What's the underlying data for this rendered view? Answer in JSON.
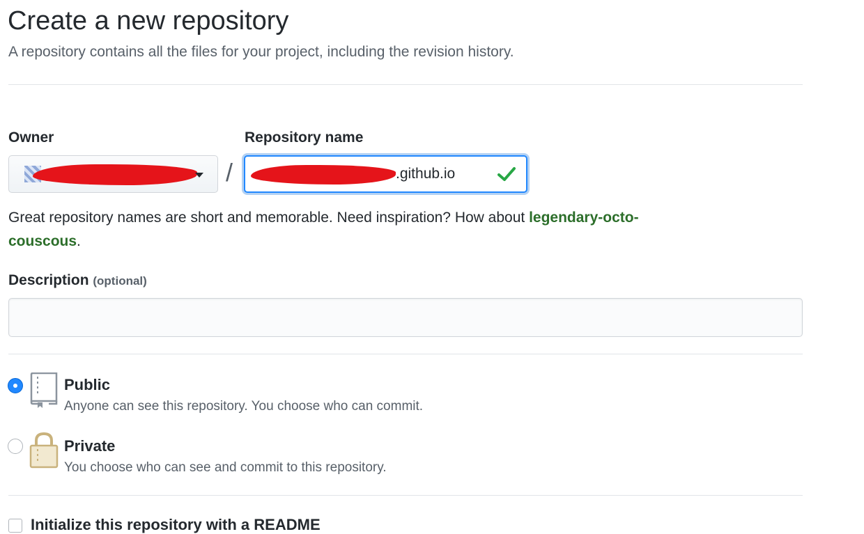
{
  "header": {
    "title": "Create a new repository",
    "subtitle": "A repository contains all the files for your project, including the revision history."
  },
  "owner": {
    "label": "Owner",
    "value": ""
  },
  "separator": "/",
  "repo_name": {
    "label": "Repository name",
    "value_suffix": ".github.io",
    "valid": true
  },
  "hint": {
    "text": "Great repository names are short and memorable. Need inspiration? How about ",
    "suggestion": "legendary-octo-couscous",
    "end": "."
  },
  "description": {
    "label": "Description",
    "optional": "(optional)",
    "value": "",
    "placeholder": ""
  },
  "visibility": {
    "selected": "public",
    "options": [
      {
        "id": "public",
        "title": "Public",
        "desc": "Anyone can see this repository. You choose who can commit.",
        "icon": "repo-icon"
      },
      {
        "id": "private",
        "title": "Private",
        "desc": "You choose who can see and commit to this repository.",
        "icon": "lock-icon"
      }
    ]
  },
  "init": {
    "label": "Initialize this repository with a README",
    "checked": false
  },
  "colors": {
    "accent": "#2188ff",
    "valid_check": "#28a745",
    "suggestion": "#2c6e2a",
    "redaction": "#e5141a"
  }
}
